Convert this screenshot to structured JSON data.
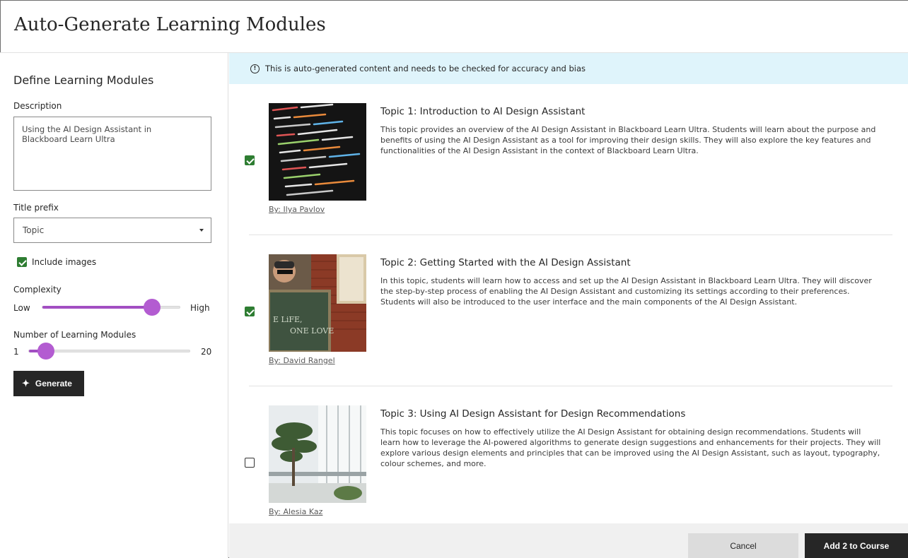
{
  "header": {
    "title": "Auto-Generate Learning Modules"
  },
  "form": {
    "section_title": "Define Learning Modules",
    "description_label": "Description",
    "description_value": "Using the AI Design Assistant in\nBlackboard Learn Ultra",
    "title_prefix_label": "Title prefix",
    "title_prefix_value": "Topic",
    "include_images_label": "Include images",
    "include_images_checked": true,
    "complexity": {
      "label": "Complexity",
      "min_label": "Low",
      "max_label": "High",
      "level": 0.8
    },
    "modules_count": {
      "label": "Number of Learning Modules",
      "min_label": "1",
      "max_label": "20",
      "min": 1,
      "max": 20,
      "value": 3
    },
    "generate_label": "Generate"
  },
  "banner": {
    "text": "This is auto-generated content and needs to be checked for accuracy and bias"
  },
  "topics": [
    {
      "checked": true,
      "title": "Topic 1: Introduction to AI Design Assistant",
      "body": "This topic provides an overview of the AI Design Assistant in Blackboard Learn Ultra. Students will learn about the purpose and benefits of using the AI Design Assistant as a tool for improving their design skills. They will also explore the key features and functionalities of the AI Design Assistant in the context of Blackboard Learn Ultra.",
      "credit": "By: Ilya Pavlov"
    },
    {
      "checked": true,
      "title": "Topic 2: Getting Started with the AI Design Assistant",
      "body": "In this topic, students will learn how to access and set up the AI Design Assistant in Blackboard Learn Ultra. They will discover the step-by-step process of enabling the AI Design Assistant and customizing its settings according to their preferences. Students will also be introduced to the user interface and the main components of the AI Design Assistant.",
      "credit": "By: David Rangel",
      "image_text": "E LiFE,\nONE LOVE"
    },
    {
      "checked": false,
      "title": "Topic 3: Using AI Design Assistant for Design Recommendations",
      "body": "This topic focuses on how to effectively utilize the AI Design Assistant for obtaining design recommendations. Students will learn how to leverage the AI-powered algorithms to generate design suggestions and enhancements for their projects. They will explore various design elements and principles that can be improved using the AI Design Assistant, such as layout, typography, colour schemes, and more.",
      "credit": "By: Alesia Kaz"
    }
  ],
  "footer": {
    "cancel_label": "Cancel",
    "add_label": "Add 2 to Course"
  },
  "colors": {
    "accent": "#b35cd1",
    "check": "#2e7d32",
    "banner": "#dff4fb",
    "primary_button": "#262626"
  }
}
